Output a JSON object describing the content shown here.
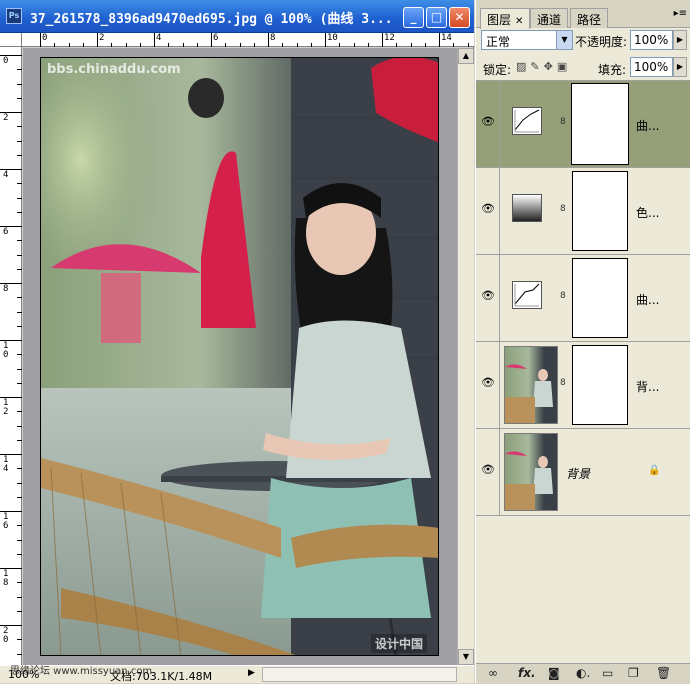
{
  "document": {
    "title": "37_261578_8396ad9470ed695.jpg @ 100% (曲线 3...",
    "app_icon": "Ps",
    "ruler_top_labels": [
      "0",
      "2",
      "4",
      "6",
      "8",
      "10",
      "12",
      "14"
    ],
    "ruler_left_labels": [
      "0",
      "2",
      "4",
      "6",
      "8",
      "10",
      "12",
      "14",
      "16",
      "18",
      "20"
    ],
    "watermark_top": "bbs.chinaddu.com",
    "watermark_bottom": "设计中国",
    "status_zoom": "100%",
    "status_doc": "文档:703.1K/1.48M",
    "credit": "思缘论坛  www.missyuan.com"
  },
  "panel": {
    "tabs": [
      "图层",
      "通道",
      "路径"
    ],
    "tab_close": "✕",
    "blend_mode": "正常",
    "opacity_label": "不透明度:",
    "opacity_value": "100%",
    "lock_label": "锁定:",
    "fill_label": "填充:",
    "fill_value": "100%",
    "layers": [
      {
        "name": "曲...",
        "kind": "curves",
        "selected": true
      },
      {
        "name": "色...",
        "kind": "gradient",
        "selected": false
      },
      {
        "name": "曲...",
        "kind": "curves",
        "selected": false
      },
      {
        "name": "背...",
        "kind": "photo-mask",
        "selected": false
      },
      {
        "name": "背景",
        "kind": "photo",
        "selected": false
      }
    ],
    "bottom_icons": [
      "link-icon",
      "fx-icon",
      "mask-icon",
      "adjustment-icon",
      "folder-icon",
      "new-layer-icon",
      "trash-icon"
    ]
  }
}
